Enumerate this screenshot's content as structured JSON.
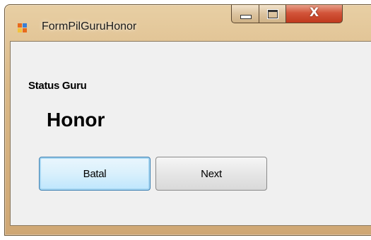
{
  "window": {
    "title": "FormPilGuruHonor",
    "icon": "app-form-icon",
    "controls": {
      "minimize": "minimize-icon",
      "maximize": "maximize-icon",
      "close_glyph": "X"
    }
  },
  "form": {
    "status_label": "Status Guru",
    "status_value": "Honor",
    "buttons": {
      "batal": "Batal",
      "next": "Next"
    }
  },
  "colors": {
    "frame": "#dbb987",
    "client": "#f0f0f0",
    "close_button": "#c0391d",
    "focus_button": "#3c7fb1"
  }
}
